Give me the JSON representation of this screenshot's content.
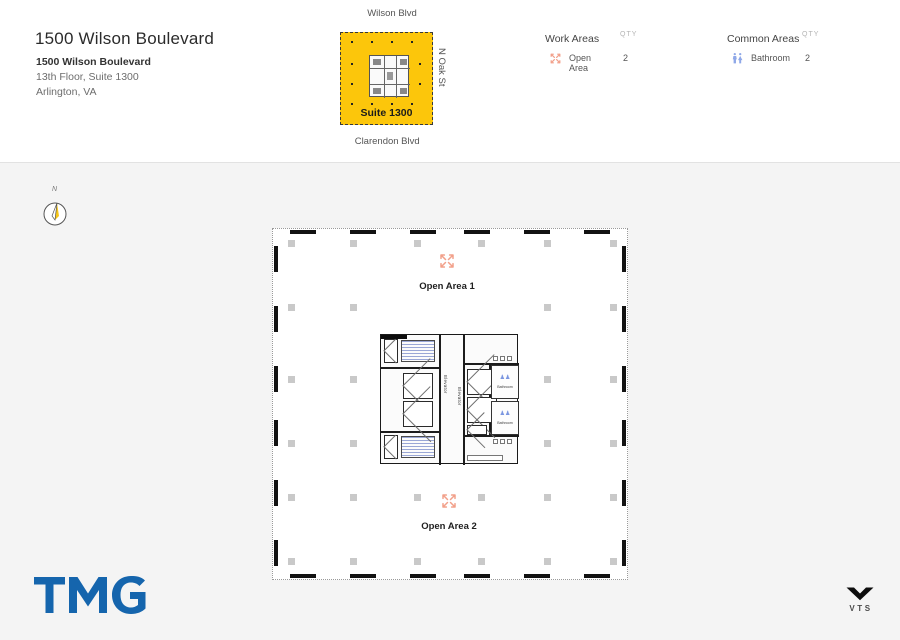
{
  "header": {
    "building_title": "1500 Wilson Boulevard",
    "address": {
      "name": "1500 Wilson Boulevard",
      "floor_suite": "13th Floor, Suite 1300",
      "city_state": "Arlington, VA"
    }
  },
  "keymap": {
    "street_north": "Wilson Blvd",
    "street_south": "Clarendon Blvd",
    "street_east": "N Oak St",
    "suite_label": "Suite 1300",
    "highlight_color": "#fcc60b"
  },
  "legend": {
    "qty_header": "QTY",
    "groups": [
      {
        "title": "Work Areas",
        "items": [
          {
            "icon": "expand-arrows-icon",
            "label": "Open Area",
            "qty": "2",
            "color": "#f2a08a"
          }
        ]
      },
      {
        "title": "Common Areas",
        "items": [
          {
            "icon": "restroom-icon",
            "label": "Bathroom",
            "qty": "2",
            "color": "#8fa8e8"
          }
        ]
      }
    ]
  },
  "compass": {
    "north_label": "N"
  },
  "plan": {
    "open_areas": [
      {
        "icon": "expand-arrows-icon",
        "label": "Open Area 1"
      },
      {
        "icon": "expand-arrows-icon",
        "label": "Open Area 2"
      }
    ],
    "core": {
      "elevator_label_left": "Elevator",
      "elevator_label_right": "Elevator",
      "bathrooms": [
        {
          "icon": "restroom-icon",
          "label": "Bathroom"
        },
        {
          "icon": "restroom-icon",
          "label": "Bathroom"
        }
      ]
    }
  },
  "footer": {
    "brand_logo": "TMG",
    "vendor_logo_text": "VTS",
    "brand_color": "#1565ad"
  }
}
